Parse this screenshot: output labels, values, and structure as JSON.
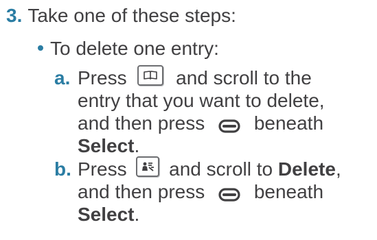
{
  "colors": {
    "text": "#414042",
    "accent": "#2b7da3",
    "key_border": "#6d6e71"
  },
  "step": {
    "number": "3.",
    "text": "Take one of these steps:"
  },
  "bullet": {
    "text": "To delete one entry:"
  },
  "substeps": [
    {
      "letter": "a.",
      "press": "Press",
      "key_icon": "phonebook-key-icon",
      "line0_after": "and scroll to the",
      "line1": "entry that you want to delete,",
      "line2_before": "and then press",
      "softkey_icon": "softkey-icon",
      "line2_after": "beneath",
      "line3_bold": "Select",
      "line3_end": "."
    },
    {
      "letter": "b.",
      "press": "Press",
      "key_icon": "menu-key-icon",
      "line0_after": "and scroll to",
      "line0_bold": "Delete",
      "line0_end": ",",
      "line1_before": "and then press",
      "softkey_icon": "softkey-icon",
      "line1_after": "beneath",
      "line2_bold": "Select",
      "line2_end": "."
    }
  ]
}
